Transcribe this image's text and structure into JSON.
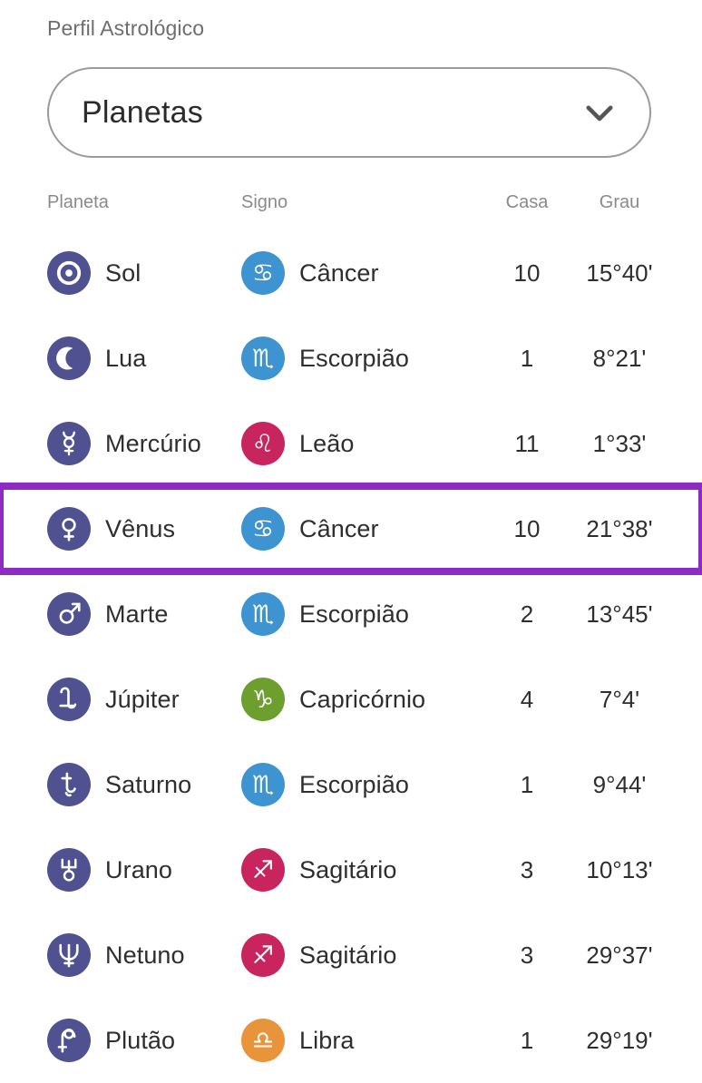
{
  "section": {
    "label": "Perfil Astrológico"
  },
  "selector": {
    "name": "profile-view-select",
    "value": "Planetas",
    "icon": "chevron-down-icon"
  },
  "table": {
    "headers": {
      "planet": "Planeta",
      "sign": "Signo",
      "house": "Casa",
      "degree": "Grau"
    },
    "highlight_color": "#8e2bc4",
    "highlighted_row_index": 3,
    "planet_icon_color": "#4f5190",
    "sign_colors": {
      "water": "#3e94d1",
      "fire": "#c8255e",
      "earth": "#6d9f2f",
      "air": "#e8943a"
    },
    "rows": [
      {
        "planet": "Sol",
        "planet_icon": "sun-icon",
        "sign": "Câncer",
        "sign_icon": "cancer-icon",
        "sign_color": "#3e94d1",
        "house": "10",
        "degree": "15°40'",
        "highlighted": false
      },
      {
        "planet": "Lua",
        "planet_icon": "moon-icon",
        "sign": "Escorpião",
        "sign_icon": "scorpio-icon",
        "sign_color": "#3e94d1",
        "house": "1",
        "degree": "8°21'",
        "highlighted": false
      },
      {
        "planet": "Mercúrio",
        "planet_icon": "mercury-icon",
        "sign": "Leão",
        "sign_icon": "leo-icon",
        "sign_color": "#c8255e",
        "house": "11",
        "degree": "1°33'",
        "highlighted": false
      },
      {
        "planet": "Vênus",
        "planet_icon": "venus-icon",
        "sign": "Câncer",
        "sign_icon": "cancer-icon",
        "sign_color": "#3e94d1",
        "house": "10",
        "degree": "21°38'",
        "highlighted": true
      },
      {
        "planet": "Marte",
        "planet_icon": "mars-icon",
        "sign": "Escorpião",
        "sign_icon": "scorpio-icon",
        "sign_color": "#3e94d1",
        "house": "2",
        "degree": "13°45'",
        "highlighted": false
      },
      {
        "planet": "Júpiter",
        "planet_icon": "jupiter-icon",
        "sign": "Capricórnio",
        "sign_icon": "capricorn-icon",
        "sign_color": "#6d9f2f",
        "house": "4",
        "degree": "7°4'",
        "highlighted": false
      },
      {
        "planet": "Saturno",
        "planet_icon": "saturn-icon",
        "sign": "Escorpião",
        "sign_icon": "scorpio-icon",
        "sign_color": "#3e94d1",
        "house": "1",
        "degree": "9°44'",
        "highlighted": false
      },
      {
        "planet": "Urano",
        "planet_icon": "uranus-icon",
        "sign": "Sagitário",
        "sign_icon": "sagittarius-icon",
        "sign_color": "#c8255e",
        "house": "3",
        "degree": "10°13'",
        "highlighted": false
      },
      {
        "planet": "Netuno",
        "planet_icon": "neptune-icon",
        "sign": "Sagitário",
        "sign_icon": "sagittarius-icon",
        "sign_color": "#c8255e",
        "house": "3",
        "degree": "29°37'",
        "highlighted": false
      },
      {
        "planet": "Plutão",
        "planet_icon": "pluto-icon",
        "sign": "Libra",
        "sign_icon": "libra-icon",
        "sign_color": "#e8943a",
        "house": "1",
        "degree": "29°19'",
        "highlighted": false
      }
    ]
  }
}
